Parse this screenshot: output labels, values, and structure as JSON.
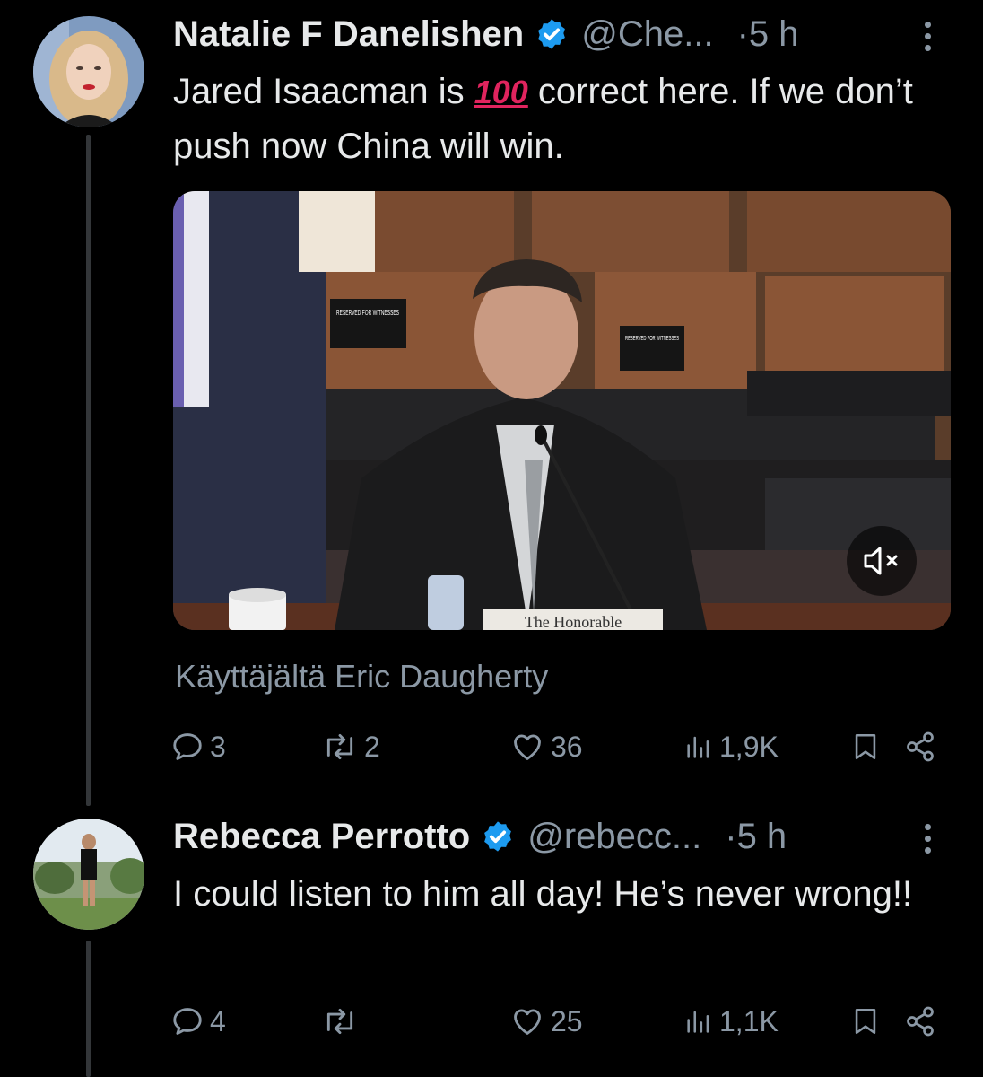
{
  "tweets": [
    {
      "name": "Natalie F Danelishen",
      "handle": "@Che...",
      "time": "·5 h",
      "text_before": "Jared Isaacman is ",
      "text_emoji": "100",
      "text_after": " correct here. If we don’t push now China will win.",
      "media": {
        "sign_left": "RESERVED FOR WITNESSES",
        "sign_right": "RESERVED FOR WITNESSES",
        "nameplate": "The Honorable"
      },
      "attribution": "Käyttäjältä Eric Daugherty",
      "actions": {
        "replies": "3",
        "reposts": "2",
        "likes": "36",
        "views": "1,9K"
      }
    },
    {
      "name": "Rebecca Perrotto",
      "handle": "@rebecc...",
      "time": "·5 h",
      "text": "I could listen to him all day!  He’s never wrong!!",
      "actions": {
        "replies": "4",
        "reposts": "",
        "likes": "25",
        "views": "1,1K"
      }
    }
  ],
  "icons": [
    "verified-badge-icon",
    "more-icon",
    "reply-icon",
    "repost-icon",
    "like-icon",
    "views-icon",
    "bookmark-icon",
    "share-icon",
    "mute-icon"
  ],
  "colors": {
    "background": "#000000",
    "text": "#e7e9ea",
    "secondary": "#8b98a5",
    "verified": "#1d9bf0",
    "thread_line": "#333639"
  }
}
